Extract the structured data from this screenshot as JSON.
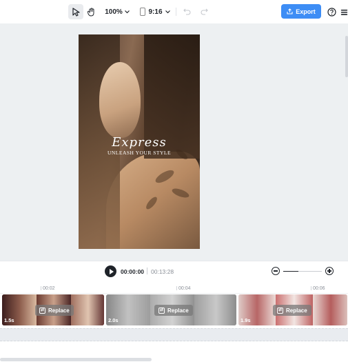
{
  "toolbar": {
    "zoom": "100%",
    "aspect_ratio": "9:16",
    "export_label": "Export",
    "accent_color": "#3d8df5",
    "icons": [
      "pointer-icon",
      "hand-icon",
      "chevron-down-icon",
      "undo-icon",
      "redo-icon",
      "help-icon",
      "more-icon"
    ]
  },
  "canvas": {
    "script_title": "Express",
    "tagline": "UNLEASH YOUR STYLE"
  },
  "playback": {
    "current_time": "00:00:00",
    "total_time": "00:13:28",
    "zoom_level": 0.4
  },
  "ruler": {
    "labels": [
      "00:02",
      "00:04",
      "00:06"
    ]
  },
  "track": {
    "clips": [
      {
        "duration": "1.5s",
        "action": "Replace"
      },
      {
        "duration": "2.0s",
        "action": "Replace"
      },
      {
        "duration": "1.9s",
        "action": "Replace"
      }
    ]
  }
}
